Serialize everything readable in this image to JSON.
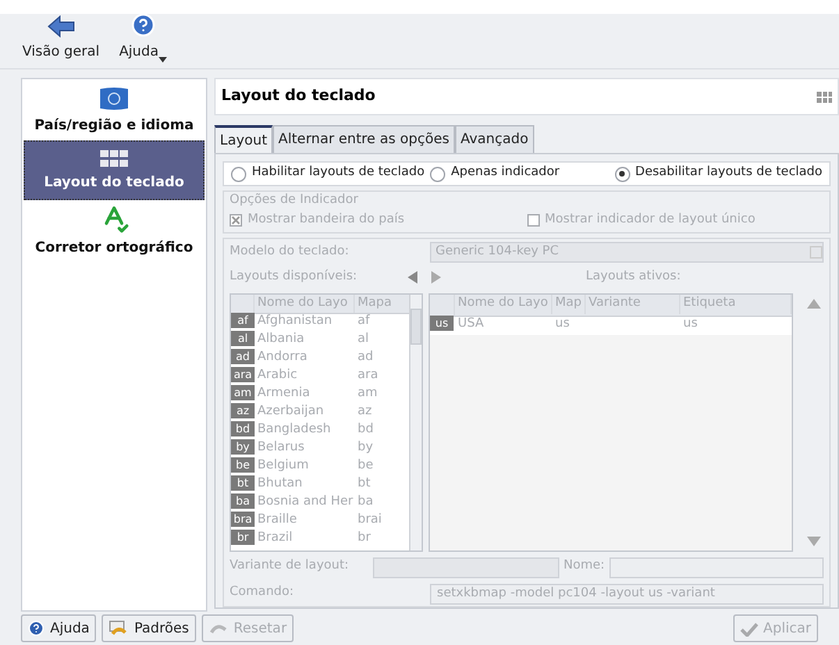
{
  "toolbar": [
    {
      "label": "Visão geral",
      "kind": "back",
      "dropdown": false
    },
    {
      "label": "Ajuda",
      "kind": "help",
      "dropdown": true
    }
  ],
  "sidebar": {
    "items": [
      {
        "label": "País/região e idioma",
        "kind": "flag",
        "selected": false
      },
      {
        "label": "Layout do teclado",
        "kind": "keyboard",
        "selected": true
      },
      {
        "label": "Corretor ortográfico",
        "kind": "spell",
        "selected": false
      }
    ]
  },
  "panel_title": "Layout do teclado",
  "tabs": [
    {
      "label": "Layout",
      "selected": true
    },
    {
      "label": "Alternar entre as opções",
      "selected": false
    },
    {
      "label": "Avançado",
      "selected": false
    }
  ],
  "mode_radios": [
    {
      "label": "Habilitar layouts de teclado",
      "selected": false
    },
    {
      "label": "Apenas indicador",
      "selected": false
    },
    {
      "label": "Desabilitar layouts de teclado",
      "selected": true
    }
  ],
  "indicator_options": {
    "title": "Opções de Indicador",
    "disabled": true,
    "checkboxes": [
      {
        "label": "Mostrar bandeira do país",
        "checked": true
      },
      {
        "label": "Mostrar indicador de layout único",
        "checked": false
      }
    ]
  },
  "layouts_disabled": true,
  "keyboard_model": {
    "label": "Modelo do teclado:",
    "value": "Generic 104-key PC"
  },
  "available_label": "Layouts disponíveis:",
  "active_label": "Layouts ativos:",
  "available_table": {
    "columns": [
      "Nome do Layo",
      "Mapa"
    ],
    "rows": [
      {
        "flag": "af",
        "name": "Afghanistan",
        "map": "af"
      },
      {
        "flag": "al",
        "name": "Albania",
        "map": "al"
      },
      {
        "flag": "ad",
        "name": "Andorra",
        "map": "ad"
      },
      {
        "flag": "ara",
        "name": "Arabic",
        "map": "ara"
      },
      {
        "flag": "am",
        "name": "Armenia",
        "map": "am"
      },
      {
        "flag": "az",
        "name": "Azerbaijan",
        "map": "az"
      },
      {
        "flag": "bd",
        "name": "Bangladesh",
        "map": "bd"
      },
      {
        "flag": "by",
        "name": "Belarus",
        "map": "by"
      },
      {
        "flag": "be",
        "name": "Belgium",
        "map": "be"
      },
      {
        "flag": "bt",
        "name": "Bhutan",
        "map": "bt"
      },
      {
        "flag": "ba",
        "name": "Bosnia and Her",
        "map": "ba"
      },
      {
        "flag": "bra",
        "name": "Braille",
        "map": "brai"
      },
      {
        "flag": "br",
        "name": "Brazil",
        "map": "br"
      }
    ]
  },
  "active_table": {
    "columns": [
      "Nome do Layo",
      "Map",
      "Variante",
      "Etiqueta"
    ],
    "rows": [
      {
        "flag": "us",
        "name": "USA",
        "map": "us",
        "variant": "",
        "label": "us"
      }
    ]
  },
  "variant": {
    "label": "Variante de layout:",
    "name_label": "Nome:"
  },
  "command": {
    "label": "Comando:",
    "value": "setxkbmap -model pc104 -layout us -variant"
  },
  "buttons_left": [
    {
      "label": "Ajuda",
      "kind": "help",
      "disabled": false
    },
    {
      "label": "Padrões",
      "kind": "defaults",
      "disabled": false
    },
    {
      "label": "Resetar",
      "kind": "reset",
      "disabled": true
    }
  ],
  "buttons_right": [
    {
      "label": "Aplicar",
      "kind": "apply",
      "disabled": true
    }
  ]
}
